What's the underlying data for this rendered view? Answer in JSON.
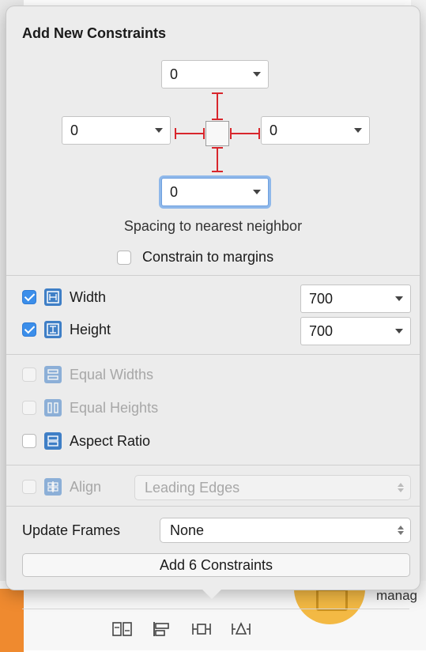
{
  "background": {
    "item_text": "manag"
  },
  "popover": {
    "title": "Add New Constraints",
    "spacing": {
      "top": "0",
      "left": "0",
      "right": "0",
      "bottom": "0",
      "caption": "Spacing to nearest neighbor"
    },
    "constrain_to_margins": {
      "label": "Constrain to margins",
      "checked": false
    },
    "size_constraints": [
      {
        "label": "Width",
        "checked": true,
        "value": "700",
        "enabled": true
      },
      {
        "label": "Height",
        "checked": true,
        "value": "700",
        "enabled": true
      }
    ],
    "relative_constraints": [
      {
        "label": "Equal Widths",
        "checked": false,
        "enabled": false
      },
      {
        "label": "Equal Heights",
        "checked": false,
        "enabled": false
      },
      {
        "label": "Aspect Ratio",
        "checked": false,
        "enabled": true
      }
    ],
    "align": {
      "label": "Align",
      "value": "Leading Edges",
      "enabled": false
    },
    "update_frames": {
      "label": "Update Frames",
      "value": "None"
    },
    "add_button_label": "Add 6 Constraints"
  },
  "colors": {
    "accent": "#3b8eea",
    "strut_red": "#d8262c",
    "icon_blue": "#3f7fc6"
  }
}
